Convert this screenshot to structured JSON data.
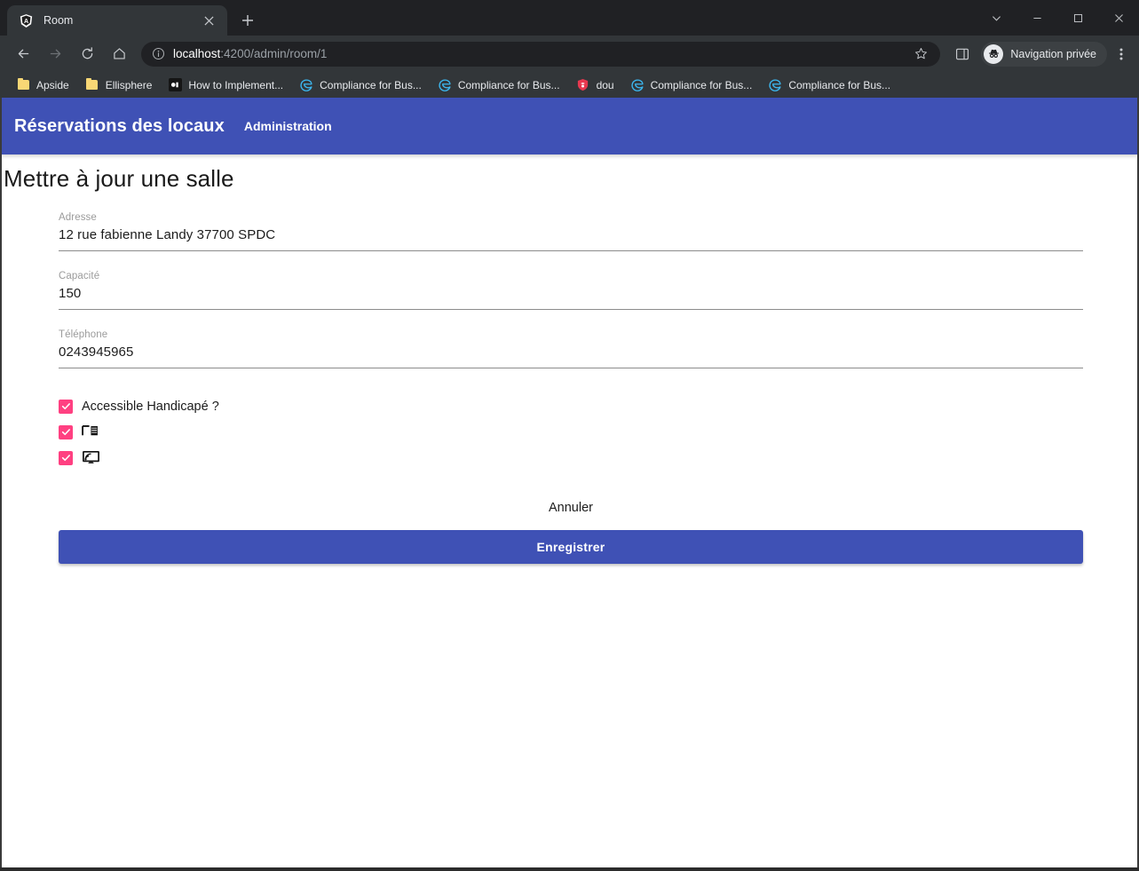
{
  "browser": {
    "tab": {
      "title": "Room",
      "favicon": "angular-shield-icon",
      "close": "×"
    },
    "new_tab_label": "+",
    "window_controls": {
      "tab_search": "⌄",
      "minimize": "—",
      "maximize": "□",
      "close": "×"
    },
    "toolbar": {
      "back": "back-arrow-icon",
      "forward": "forward-arrow-icon",
      "reload": "reload-icon",
      "home": "home-icon",
      "url_host": "localhost",
      "url_path": ":4200/admin/room/1",
      "url_full": "localhost:4200/admin/room/1",
      "site_info": "info-circle-icon",
      "bookmark_star": "star-icon",
      "side_panel": "side-panel-icon",
      "profile_label": "Navigation privée",
      "menu": "three-dots-icon"
    },
    "bookmarks": [
      {
        "label": "Apside",
        "icon": "folder-icon"
      },
      {
        "label": "Ellisphere",
        "icon": "folder-icon"
      },
      {
        "label": "How to Implement...",
        "icon": "dark-square-icon"
      },
      {
        "label": "Compliance for Bus...",
        "icon": "edge-icon"
      },
      {
        "label": "Compliance for Bus...",
        "icon": "edge-icon"
      },
      {
        "label": "dou",
        "icon": "shield-icon"
      },
      {
        "label": "Compliance for Bus...",
        "icon": "edge-icon"
      },
      {
        "label": "Compliance for Bus...",
        "icon": "edge-icon"
      }
    ]
  },
  "app": {
    "title": "Réservations des locaux",
    "nav_link": "Administration",
    "page_heading": "Mettre à jour une salle",
    "colors": {
      "primary": "#3f51b5",
      "accent": "#ff4081"
    },
    "form": {
      "fields": [
        {
          "label": "Adresse",
          "value": "12 rue fabienne Landy 37700 SPDC"
        },
        {
          "label": "Capacité",
          "value": "150"
        },
        {
          "label": "Téléphone",
          "value": "0243945965"
        }
      ],
      "checkboxes": [
        {
          "label": "Accessible Handicapé ?",
          "checked": true,
          "kind": "text"
        },
        {
          "label": "⊓𝍖",
          "checked": true,
          "kind": "icon",
          "icon": "whiteboard-icon"
        },
        {
          "label": "🖧",
          "checked": true,
          "kind": "icon",
          "icon": "screen-cast-icon"
        }
      ],
      "cancel_label": "Annuler",
      "save_label": "Enregistrer"
    }
  }
}
